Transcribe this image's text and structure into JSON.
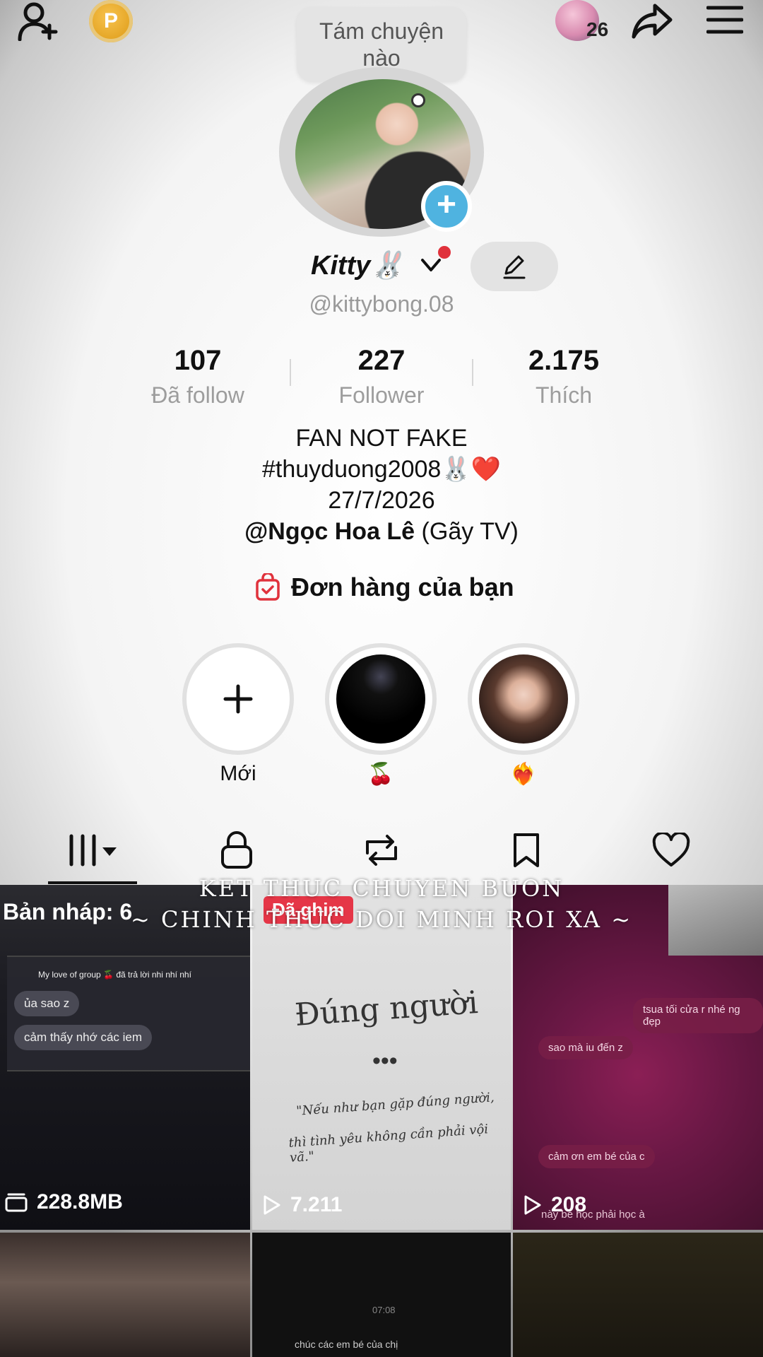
{
  "topbar": {
    "add_friend_icon": "person-add-icon",
    "coin_label": "P",
    "notification_count": "26",
    "share_icon": "share-arrow-icon",
    "menu_icon": "hamburger-menu-icon"
  },
  "tooltip": {
    "text": "Tám chuyện nào"
  },
  "profile": {
    "display_name": "Kitty🐰",
    "username": "@kittybong.08"
  },
  "stats": [
    {
      "value": "107",
      "label": "Đã follow"
    },
    {
      "value": "227",
      "label": "Follower"
    },
    {
      "value": "2.175",
      "label": "Thích"
    }
  ],
  "bio": {
    "line1": "FAN NOT FAKE",
    "line2": "#thuyduong2008🐰❤️",
    "line3": "27/7/2026",
    "mention": "@Ngọc Hoa Lê",
    "mention_suffix": " (Gãy TV)"
  },
  "order_link": {
    "label": "Đơn hàng của bạn"
  },
  "highlights": [
    {
      "label": "Mới"
    },
    {
      "label": "🍒"
    },
    {
      "label": "❤️‍🔥"
    }
  ],
  "tabs": [
    "videos",
    "private",
    "reposts",
    "favorites",
    "liked"
  ],
  "overlay": {
    "line1": "KET THUC CHUYEN BUON",
    "line2": "~ CHINH THUC DOI MINH ROI XA ~"
  },
  "grid": {
    "draft_label": "Bản nháp: 6",
    "draft_size": "228.8MB",
    "pinned_label": "Đã ghim",
    "cell2_title": "Đúng người",
    "cell2_quote_1": "\"Nếu như bạn gặp đúng người,",
    "cell2_quote_2": "thì tình yêu không cần phải vội vã.\"",
    "cell2_views": "7.211",
    "cell3_views": "208",
    "cell1_bubble_1": "My love of group 🍒 đã trả lời nhi nhí nhí",
    "cell1_bubble_2": "ủa sao z",
    "cell1_bubble_3": "cảm thấy nhớ các iem",
    "cell3_bubble_1": "tsua tối cửa r nhé ng đẹp",
    "cell3_bubble_2": "sao mà iu đến z",
    "cell3_bubble_3": "cảm ơn em bé của c",
    "cell3_bubble_4": "này bé học phải học à",
    "cell5_time": "07:08",
    "cell5_bubble": "chúc các em bé của chị"
  }
}
